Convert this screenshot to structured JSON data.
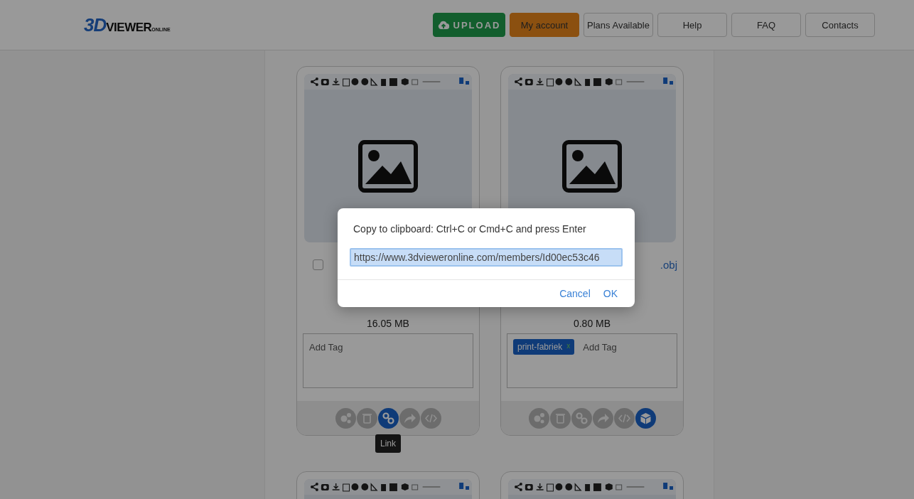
{
  "header": {
    "logo": {
      "mark": "3D",
      "word": "VIEWER",
      "suffix": "ONLINE"
    },
    "nav": [
      {
        "label": "UPLOAD",
        "kind": "upload"
      },
      {
        "label": "My account",
        "kind": "account"
      },
      {
        "label": "Plans Available",
        "kind": "plain"
      },
      {
        "label": "Help",
        "kind": "plain"
      },
      {
        "label": "FAQ",
        "kind": "plain"
      },
      {
        "label": "Contacts",
        "kind": "plain"
      }
    ]
  },
  "cards": [
    {
      "kind": "full",
      "checked": false,
      "size": "16.05 MB",
      "tag_placeholder": "Add Tag",
      "actions": [
        {
          "kind": "settings",
          "selected": false
        },
        {
          "kind": "delete",
          "selected": false
        },
        {
          "kind": "link",
          "selected": true,
          "tooltip": "Link"
        },
        {
          "kind": "share",
          "selected": false
        },
        {
          "kind": "embed",
          "selected": false
        }
      ]
    },
    {
      "kind": "full",
      "filename": ".obj",
      "size": "0.80 MB",
      "tags": [
        {
          "label": "print-fabriek",
          "remove": "x"
        }
      ],
      "tag_placeholder": "Add Tag",
      "actions": [
        {
          "kind": "settings",
          "selected": false
        },
        {
          "kind": "delete",
          "selected": false
        },
        {
          "kind": "link",
          "selected": false
        },
        {
          "kind": "share",
          "selected": false
        },
        {
          "kind": "embed",
          "selected": false
        },
        {
          "kind": "view3d",
          "selected": true
        }
      ]
    },
    {
      "kind": "cut"
    },
    {
      "kind": "cut"
    }
  ],
  "dialog": {
    "message": "Copy to clipboard: Ctrl+C or Cmd+C and press Enter",
    "value": "https://www.3dvieweronline.com/members/Id00ec53c46",
    "buttons": [
      {
        "label": "Cancel"
      },
      {
        "label": "OK"
      }
    ]
  }
}
